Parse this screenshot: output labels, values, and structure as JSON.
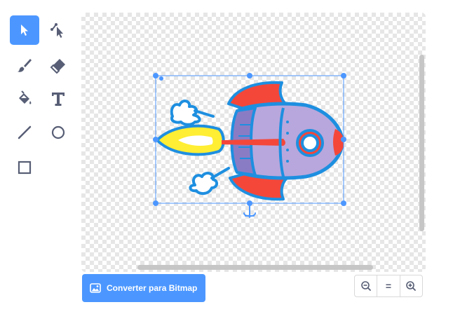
{
  "tools": [
    {
      "icon": "select-arrow-icon",
      "selected": true
    },
    {
      "icon": "reshape-icon",
      "selected": false
    },
    {
      "icon": "brush-icon",
      "selected": false
    },
    {
      "icon": "eraser-icon",
      "selected": false
    },
    {
      "icon": "fill-bucket-icon",
      "selected": false
    },
    {
      "icon": "text-tool-icon",
      "selected": false
    },
    {
      "icon": "line-icon",
      "selected": false
    },
    {
      "icon": "circle-icon",
      "selected": false
    },
    {
      "icon": "rectangle-icon",
      "selected": false
    }
  ],
  "convert_button": {
    "label": "Converter para Bitmap",
    "icon": "image-icon"
  },
  "zoom": {
    "zoom_out_icon": "zoom-out-icon",
    "reset_label": "=",
    "zoom_in_icon": "zoom-in-icon"
  },
  "costume": {
    "description_icon": "rocket-costume"
  },
  "colors": {
    "accent": "#4c97ff",
    "icon": "#575e75",
    "rocket_outline": "#1e8fe0",
    "rocket_body": "#b8a7dc",
    "rocket_red": "#f4473a",
    "flame_yellow": "#ffee33"
  }
}
